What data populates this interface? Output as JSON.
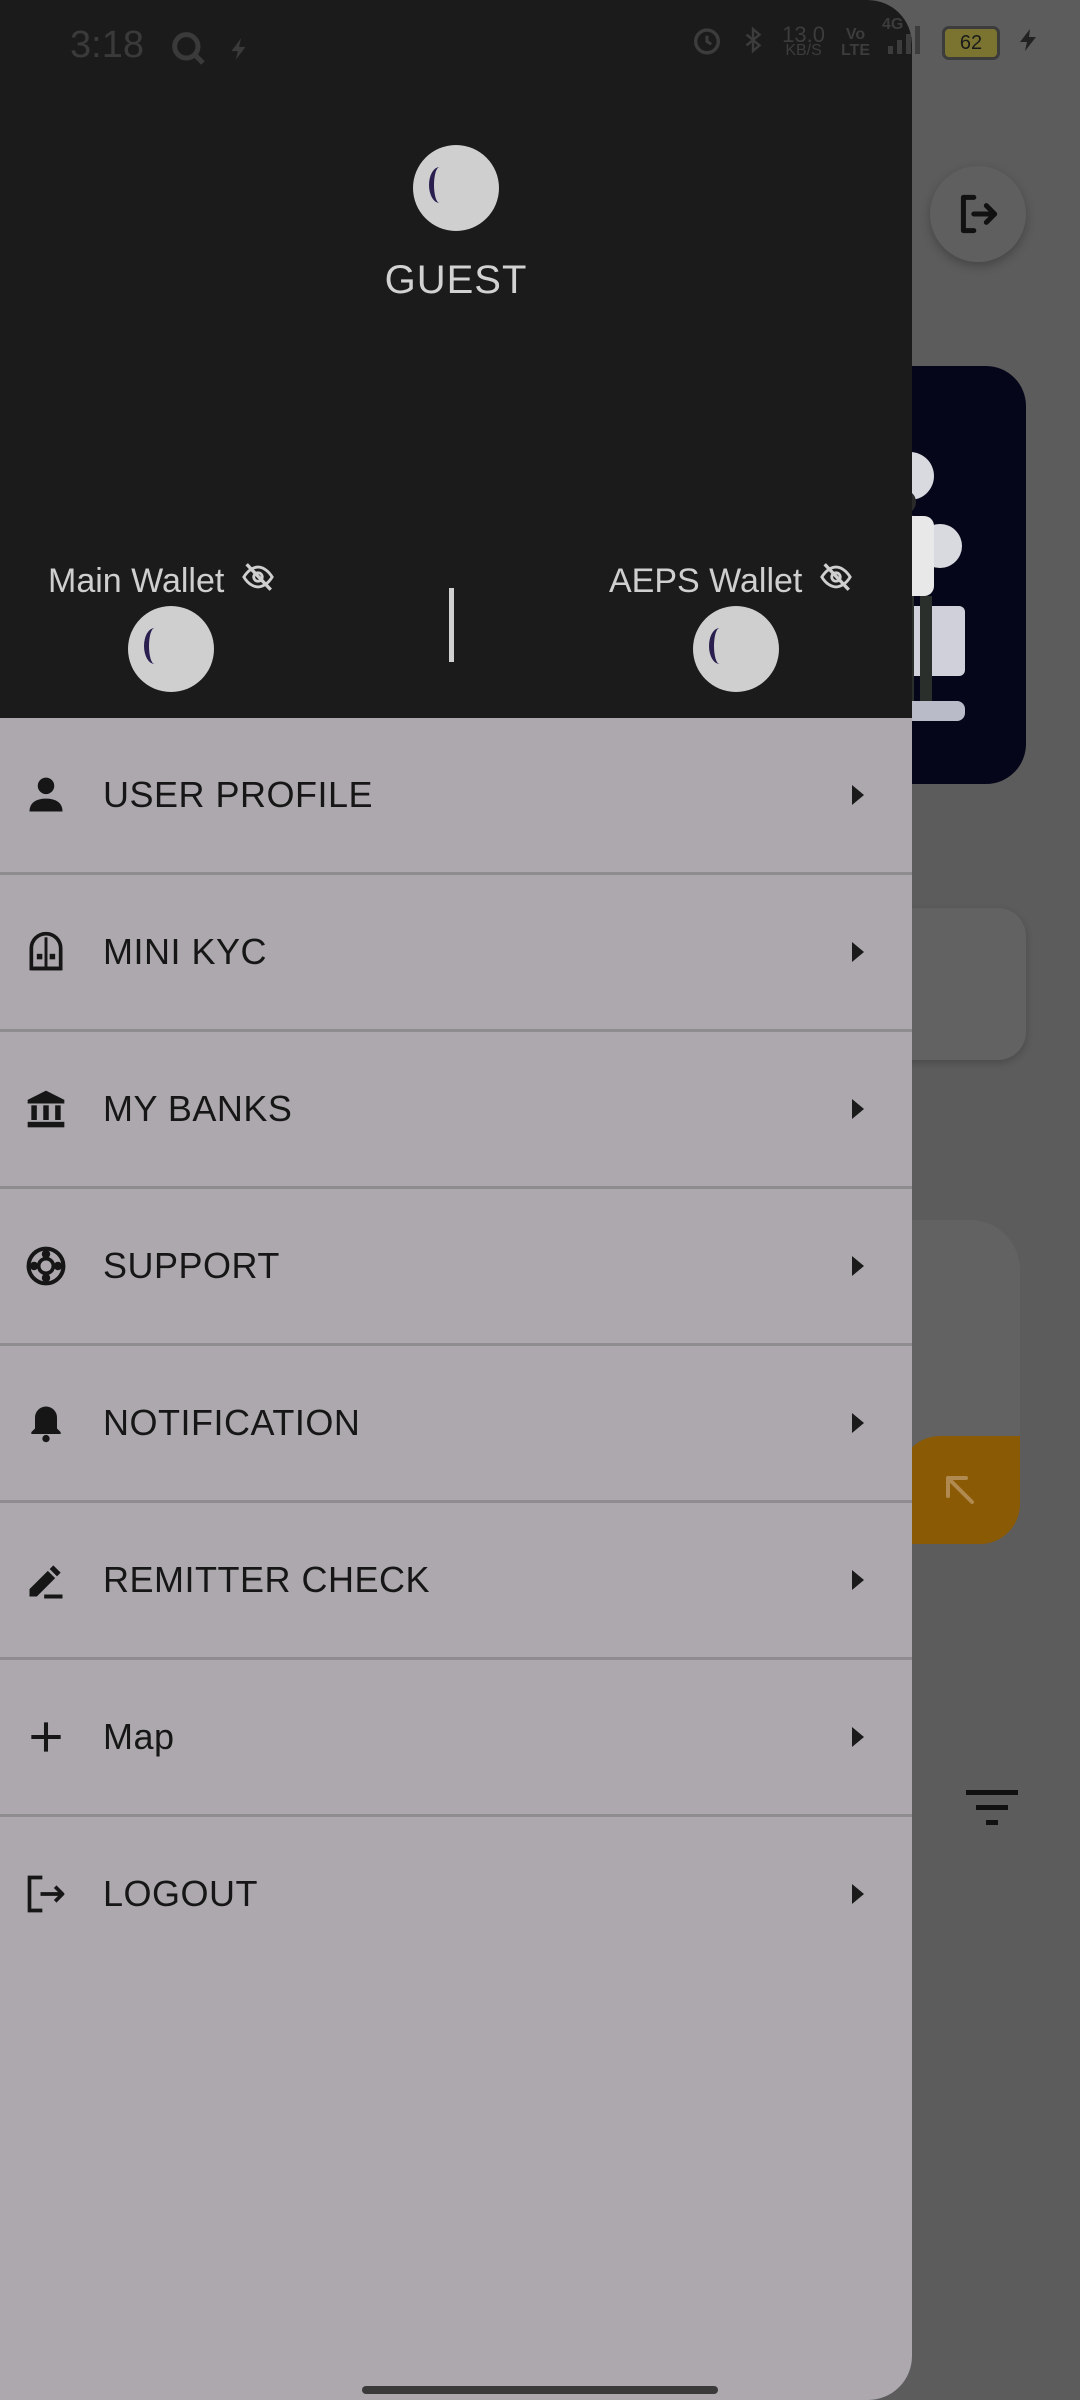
{
  "status_bar": {
    "time": "3:18",
    "net_speed_value": "13.0",
    "net_speed_unit": "KB/S",
    "volte": "Vo\nLTE",
    "network": "4G",
    "battery": "62"
  },
  "drawer": {
    "user_name": "GUEST",
    "wallets": [
      {
        "label": "Main Wallet"
      },
      {
        "label": "AEPS Wallet"
      }
    ],
    "menu": [
      {
        "label": "USER PROFILE",
        "icon": "person-icon"
      },
      {
        "label": "MINI KYC",
        "icon": "kyc-icon"
      },
      {
        "label": "MY BANKS",
        "icon": "bank-icon"
      },
      {
        "label": "SUPPORT",
        "icon": "support-lifebuoy-icon"
      },
      {
        "label": "NOTIFICATION",
        "icon": "bell-icon"
      },
      {
        "label": "REMITTER CHECK",
        "icon": "edit-icon"
      },
      {
        "label": "Map",
        "icon": "plus-icon"
      },
      {
        "label": "LOGOUT",
        "icon": "logout-icon"
      }
    ]
  },
  "colors": {
    "drawer_header": "#1b1b1b",
    "drawer_body": "#aca8ae",
    "scrim_background": "#5c5c5c",
    "accent_orange": "#8a5a05"
  }
}
